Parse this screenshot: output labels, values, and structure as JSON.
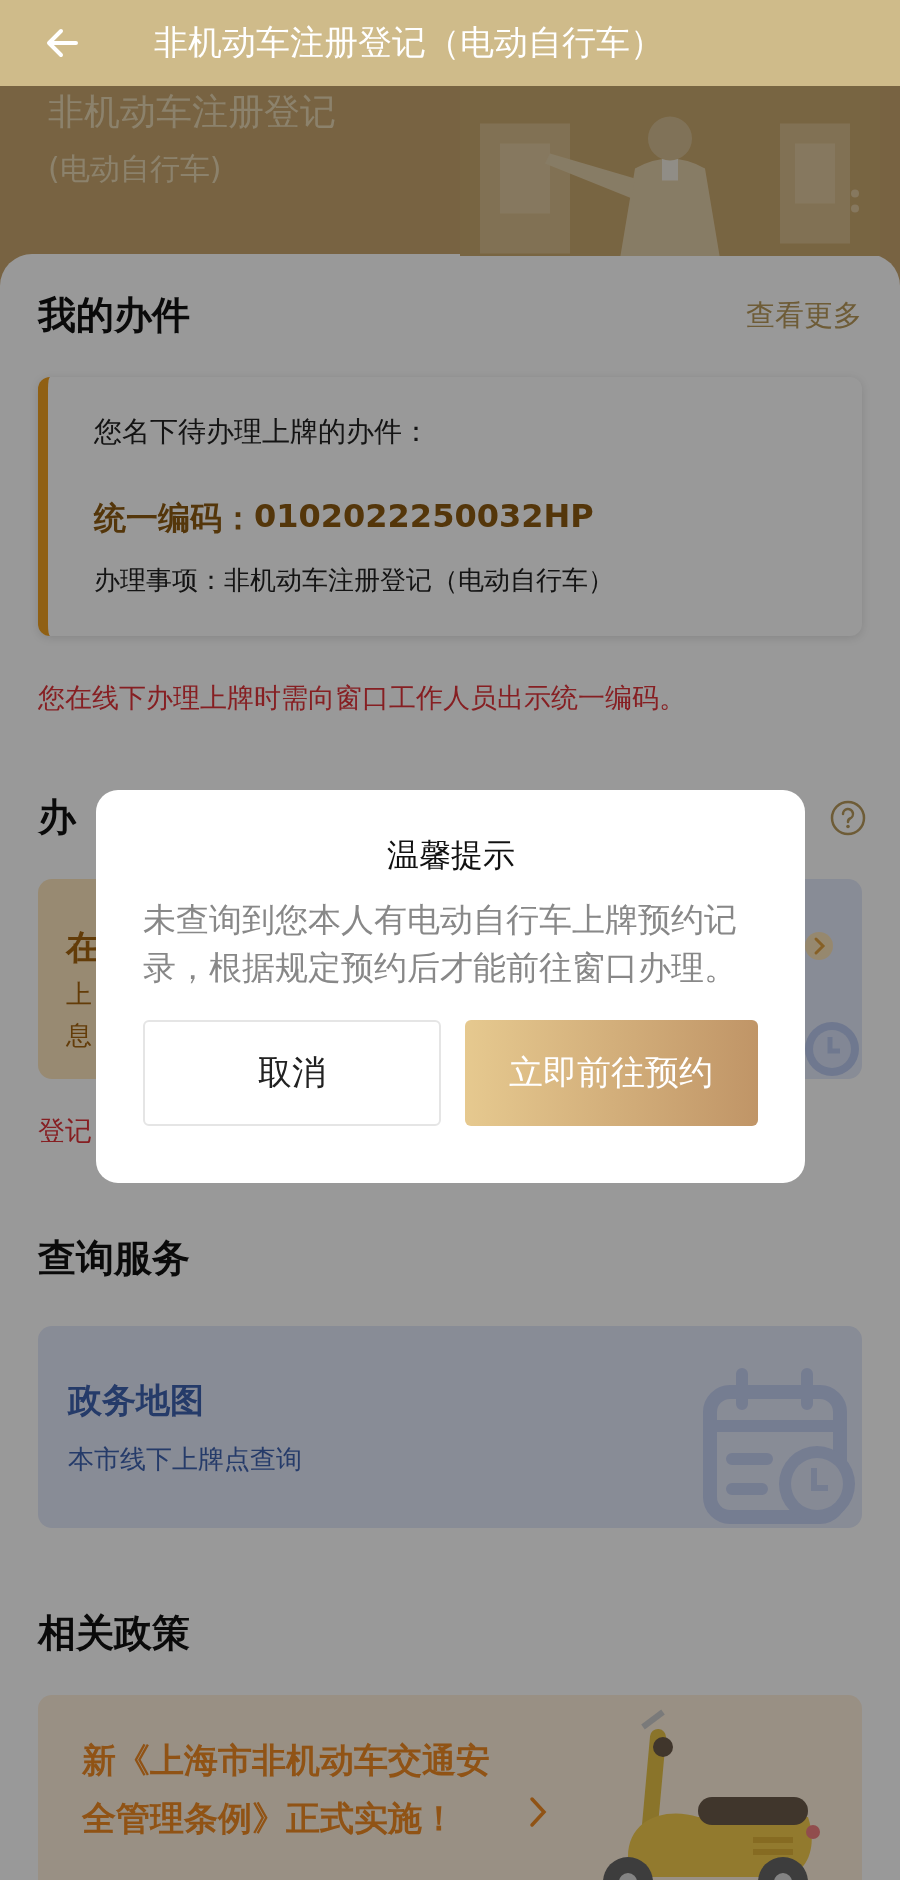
{
  "top_bar": {
    "title": "非机动车注册登记（电动自行车）"
  },
  "banner": {
    "title": "非机动车注册登记",
    "subtitle": "(电动自行车)"
  },
  "my_cases": {
    "heading": "我的办件",
    "more_link": "查看更多",
    "case": {
      "intro": "您名下待办理上牌的办件：",
      "code_label": "统一编码：",
      "code": "0102022250032HP",
      "item": "办理事项：非机动车注册登记（电动自行车）"
    },
    "note": "您在线下办理上牌时需向窗口工作人员出示统一编码。"
  },
  "handling": {
    "heading": "办",
    "card_title": "在",
    "card_lines": [
      "上",
      "息"
    ],
    "note": "登记"
  },
  "dialog": {
    "title": "温馨提示",
    "message": "未查询到您本人有电动自行车上牌预约记录，根据规定预约后才能前往窗口办理。",
    "buttons": [
      {
        "kind": "secondary",
        "label": "取消"
      },
      {
        "kind": "primary",
        "label": "立即前往预约"
      }
    ]
  },
  "query_services": {
    "heading": "查询服务",
    "card": {
      "title": "政务地图",
      "subtitle": "本市线下上牌点查询"
    }
  },
  "policies": {
    "heading": "相关政策",
    "card": {
      "text": "新《上海市非机动车交通安全管理条例》正式实施！"
    }
  }
}
